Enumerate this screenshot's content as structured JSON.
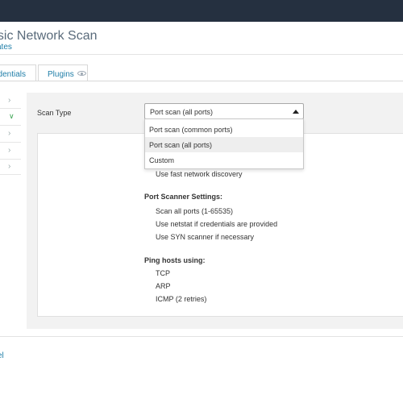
{
  "header": {
    "title": "asic Network Scan",
    "sublink": "ates"
  },
  "tabs": [
    {
      "label": "edentials"
    },
    {
      "label": "Plugins",
      "icon": "eye-icon"
    }
  ],
  "sidebar": {
    "items": [
      {
        "icon": "chevron-right-icon"
      },
      {
        "icon": "chevron-down-icon",
        "active": true
      },
      {
        "icon": "chevron-right-icon"
      },
      {
        "icon": "chevron-right-icon"
      },
      {
        "icon": "chevron-right-icon"
      }
    ]
  },
  "form": {
    "scan_type_label": "Scan Type",
    "select_value": "Port scan (all ports)",
    "options": [
      "Port scan (common ports)",
      "Port scan (all ports)",
      "Custom"
    ],
    "selected_index": 1
  },
  "settings": {
    "discovery_item": "Use fast network discovery",
    "port_scanner_heading": "Port Scanner Settings:",
    "port_scanner_items": [
      "Scan all ports (1-65535)",
      "Use netstat if credentials are provided",
      "Use SYN scanner if necessary"
    ],
    "ping_heading": "Ping hosts using:",
    "ping_items": [
      "TCP",
      "ARP",
      "ICMP (2 retries)"
    ]
  },
  "footer": {
    "cancel_label": "cel"
  },
  "colors": {
    "topbar": "#253040",
    "link": "#1f7ea8",
    "active_chevron": "#39a350"
  }
}
